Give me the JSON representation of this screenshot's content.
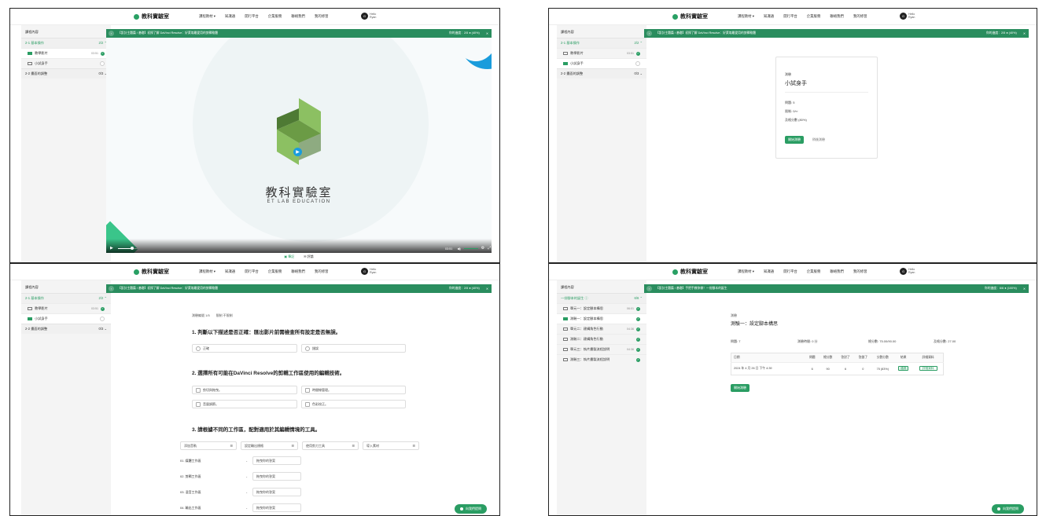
{
  "brand": "教科實驗室",
  "nav": [
    "課程教材 ▾",
    "知識通",
    "開行平台",
    "企業服務",
    "聯絡我們",
    "我的修習"
  ],
  "avatar": {
    "letter": "G",
    "line1": "Hello",
    "line2": "Ryan"
  },
  "sidebar_title": "課程內容",
  "panel1": {
    "breadcrumb": "【設計主題篇 / 基礎】初探了解 DaVinci Resolve：好萊塢最愛用的剪輯軟體",
    "sections": [
      {
        "label": "2-1 基本操作",
        "count": "2/2 ⌃"
      },
      {
        "label": "2-2 畫面的調整",
        "count": "0/3 ⌄"
      }
    ],
    "items": [
      {
        "label": "教學影片",
        "time": "03:51"
      },
      {
        "label": "小試身手",
        "time": ""
      }
    ],
    "logo_cn": "教科實驗室",
    "logo_en": "ET LAB EDUCATION",
    "controls": {
      "time": "03:51",
      "speed": "1x"
    },
    "tabs": [
      "▣ 筆記",
      "✉ 評論"
    ],
    "top_right": "你的進度：2/5 ● (40%)"
  },
  "panel2": {
    "breadcrumb": "【設計主題篇 / 基礎】初探了解 DaVinci Resolve：好萊塢最愛用的剪輯軟體",
    "top_right": "你的進度：2/5 ● (40%)",
    "sections": [
      {
        "label": "2-1 基本操作",
        "count": "2/2 ⌃"
      },
      {
        "label": "2-2 畫面的調整",
        "count": "0/3 ⌄"
      }
    ],
    "items": [
      {
        "label": "教學影片",
        "time": "03:51"
      },
      {
        "label": "小試身手",
        "time": ""
      }
    ],
    "quiz_label": "測驗",
    "quiz_title": "小試身手",
    "info": [
      "問題: 5",
      "限制: 0/∞",
      "及格分數 (80%)"
    ],
    "start": "開始測驗",
    "later": "稍後測驗"
  },
  "panel3": {
    "breadcrumb": "【設計主題篇 / 基礎】初探了解 DaVinci Resolve：好萊塢最愛用的剪輯軟體",
    "top_right": "你的進度：2/5 ● (40%)",
    "sections": [
      {
        "label": "2-1 基本操作",
        "count": "2/2 ⌃"
      },
      {
        "label": "2-2 畫面的調整",
        "count": "0/3 ⌄"
      }
    ],
    "items": [
      {
        "label": "教學影片",
        "time": "03:51"
      },
      {
        "label": "小試身手",
        "time": ""
      }
    ],
    "progress": "測驗編號 1/5",
    "limit": "限制 不限制",
    "q1": "1. 判斷以下描述是否正確：匯出影片前需檢查所有設定是否無誤。",
    "q1_opts": [
      "正確",
      "錯誤"
    ],
    "q2": "2. 選擇所有可能在DaVinci Resolve的剪輯工作區使用的編輯技術。",
    "q2_opts": [
      "剪切與拖曳。",
      "時間線管理。",
      "音量調節。",
      "色彩校正。"
    ],
    "q3": "3. 請根據不同的工作區，配對適用於其編輯情境的工具。",
    "q3_tools": [
      "添加音軌",
      "設定輸出規格",
      "使用剪刀工具",
      "導入素材"
    ],
    "q3_rows": [
      "01. 媒體工作區",
      "02. 剪輯工作區",
      "03. 混音工作區",
      "04. 輸出工作區"
    ],
    "drop_placeholder": "拖曳你的答案",
    "help": "向我們提問"
  },
  "panel4": {
    "breadcrumb": "【設計主題篇 / 基礎】手把手教你做！一份腳本的誕生",
    "top_right": "你的進度：6/6 ● (100%)",
    "sections": [
      {
        "label": "一份腳本的誕生 ⓘ",
        "count": "6/6 ⌃"
      }
    ],
    "items": [
      {
        "label": "單元一：設定腳本構思",
        "time": "06:01"
      },
      {
        "label": "測驗一：設定腳本構思",
        "time": ""
      },
      {
        "label": "單元二：建構角色行動",
        "time": "04:36"
      },
      {
        "label": "測驗二：建構角色行動",
        "time": ""
      },
      {
        "label": "單元三：執片畫製流程說明",
        "time": "04:36"
      },
      {
        "label": "測驗三：執片畫製流程說明",
        "time": ""
      }
    ],
    "quiz_label": "測驗",
    "quiz_title": "測驗一：設定腳本構思",
    "stats": [
      "問題: 7",
      "測驗時間: 0 分",
      "總分數: 75.00/90.00",
      "及格分數: 27.00"
    ],
    "table_headers": [
      "日期",
      "問題",
      "總分數",
      "答對了",
      "答錯了",
      "分數分數",
      "結果",
      "詳細資料"
    ],
    "table_row": [
      "2024 年 4 月 26 日 下午 4:39",
      "6",
      "90",
      "6",
      "0",
      "75 (83%)",
      "通過",
      "詳細資料"
    ],
    "restart": "開始測驗",
    "help": "向我們提問"
  }
}
